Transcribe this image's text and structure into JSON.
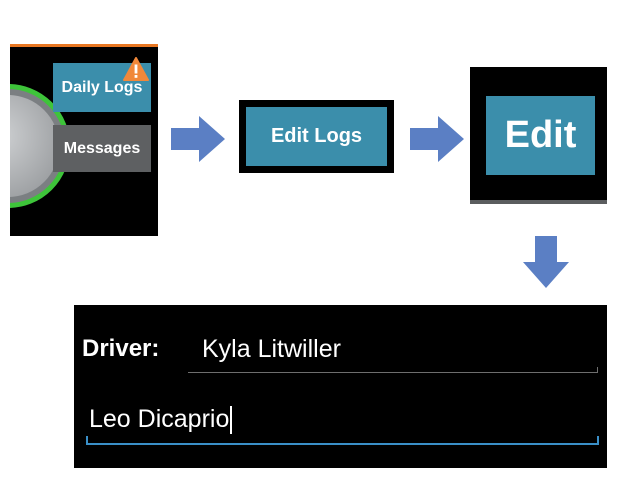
{
  "step1": {
    "daily_logs_label": "Daily Logs",
    "messages_label": "Messages",
    "warning_icon": "warning-triangle-icon"
  },
  "step2": {
    "edit_logs_label": "Edit Logs"
  },
  "step3": {
    "edit_label": "Edit"
  },
  "form": {
    "driver_label": "Driver:",
    "driver_value": "Kyla Litwiller",
    "codriver_value": "Leo Dicaprio"
  },
  "colors": {
    "button_blue": "#3b8eab",
    "button_gray": "#5e6062",
    "arrow_blue": "#5b7fc4",
    "warning_orange": "#f0883a",
    "focus_underline": "#3a8fc7"
  }
}
